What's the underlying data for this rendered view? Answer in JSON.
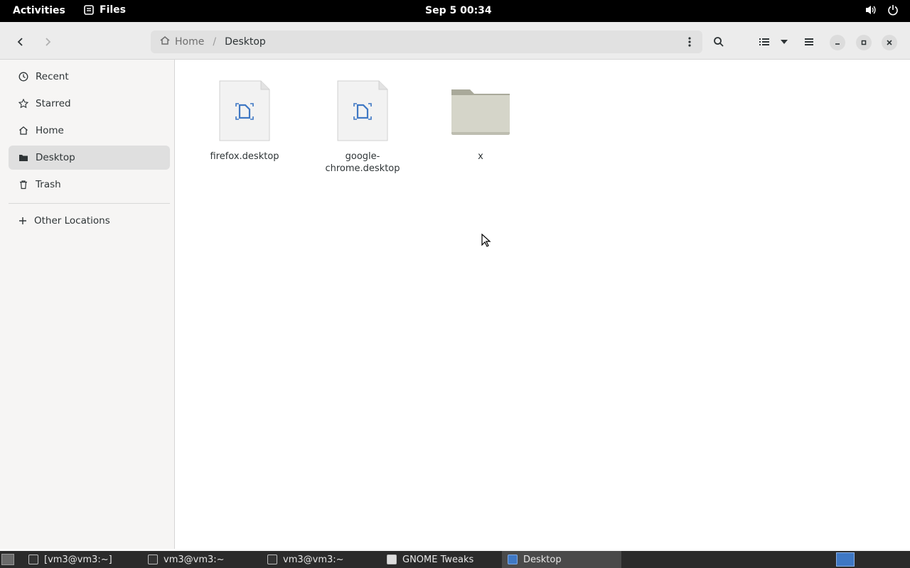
{
  "topbar": {
    "activities": "Activities",
    "app_name": "Files",
    "clock": "Sep 5  00:34"
  },
  "headerbar": {
    "path": [
      {
        "label": "Home",
        "icon": "home-icon"
      },
      {
        "label": "Desktop"
      }
    ]
  },
  "sidebar": {
    "items": [
      {
        "label": "Recent",
        "icon": "clock-icon"
      },
      {
        "label": "Starred",
        "icon": "star-icon"
      },
      {
        "label": "Home",
        "icon": "home-icon"
      },
      {
        "label": "Desktop",
        "icon": "folder-icon",
        "active": true
      },
      {
        "label": "Trash",
        "icon": "trash-icon"
      }
    ],
    "other_locations": "Other Locations"
  },
  "files": [
    {
      "name": "firefox.desktop",
      "type": "document"
    },
    {
      "name": "google-chrome.desktop",
      "type": "document"
    },
    {
      "name": "x",
      "type": "folder"
    }
  ],
  "taskbar": {
    "items": [
      {
        "label": "[vm3@vm3:~]"
      },
      {
        "label": "vm3@vm3:~"
      },
      {
        "label": "vm3@vm3:~"
      },
      {
        "label": "GNOME Tweaks"
      },
      {
        "label": "Desktop",
        "active": true
      }
    ]
  },
  "colors": {
    "accent": "#3584e4",
    "topbar": "#000000",
    "sidebar_active": "#dfdfdf"
  }
}
